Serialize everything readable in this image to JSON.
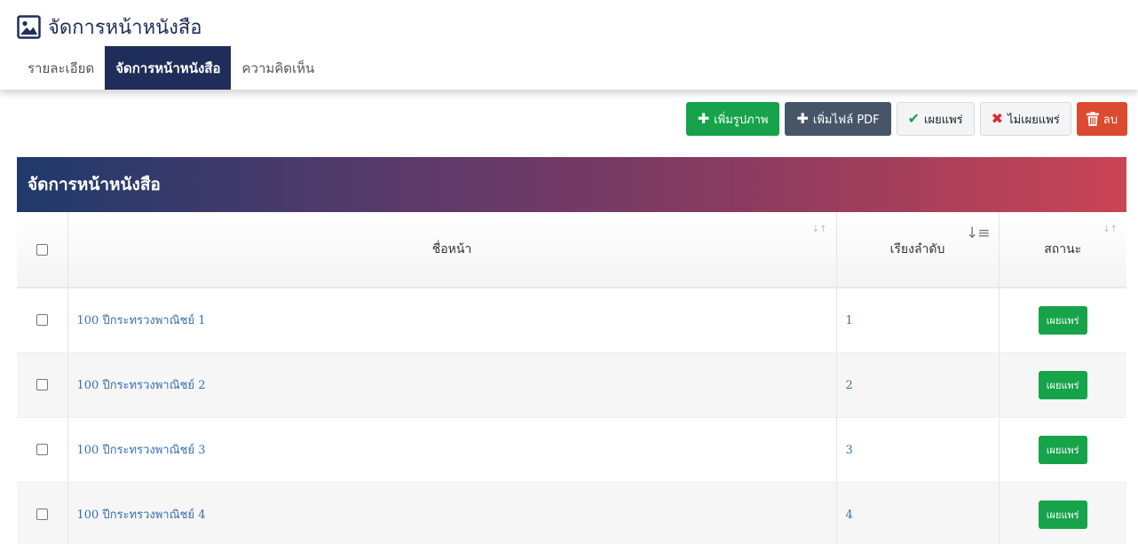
{
  "header": {
    "title": "จัดการหน้าหนังสือ",
    "tabs": [
      {
        "label": "รายละเอียด",
        "active": false
      },
      {
        "label": "จัดการหน้าหนังสือ",
        "active": true
      },
      {
        "label": "ความคิดเห็น",
        "active": false
      }
    ]
  },
  "toolbar": {
    "add_image": "เพิ่มรูปภาพ",
    "add_pdf": "เพิ่มไฟล์ PDF",
    "publish": "เผยแพร่",
    "unpublish": "ไม่เผยแพร่",
    "delete": "ลบ"
  },
  "panel": {
    "title": "จัดการหน้าหนังสือ",
    "columns": {
      "name": "ชื่อหน้า",
      "order": "เรียงลำดับ",
      "status": "สถานะ"
    },
    "rows": [
      {
        "name": "100 ปีกระทรวงพาณิชย์ 1",
        "order": "1",
        "status": "เผยแพร่"
      },
      {
        "name": "100 ปีกระทรวงพาณิชย์ 2",
        "order": "2",
        "status": "เผยแพร่"
      },
      {
        "name": "100 ปีกระทรวงพาณิชย์ 3",
        "order": "3",
        "status": "เผยแพร่"
      },
      {
        "name": "100 ปีกระทรวงพาณิชย์ 4",
        "order": "4",
        "status": "เผยแพร่"
      }
    ]
  },
  "colors": {
    "navy": "#1f2d5a",
    "green": "#16a34a",
    "slate": "#475569",
    "red": "#dc4a2f",
    "link": "#3a6fb0"
  },
  "icons": {
    "title": "image-file-icon",
    "add": "plus-icon",
    "publish": "check-icon",
    "unpublish": "x-icon",
    "delete": "trash-icon",
    "sort": "sort-icon"
  }
}
